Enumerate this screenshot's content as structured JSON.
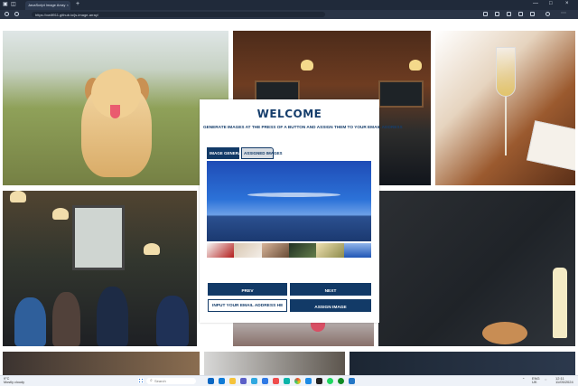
{
  "browser": {
    "tab_title": "JavaScript Image Array",
    "tab_close": "×",
    "new_tab": "+",
    "url": "https://xwill911.github.io/js-image-array/",
    "window_controls": [
      "—",
      "□",
      "×"
    ]
  },
  "modal": {
    "title": "WELCOME",
    "subtitle": "GENERATE IMAGES AT THE PRESS OF A BUTTON AND ASSIGN THEM TO YOUR EMAIL ADDRESS",
    "tabs": [
      {
        "label": "IMAGE GENERATOR"
      },
      {
        "label": "ASSIGNED IMAGES"
      }
    ],
    "buttons": {
      "prev": "PREV",
      "next": "NEXT",
      "assign": "ASSIGN IMAGE"
    },
    "email_placeholder": "INPUT YOUR EMAIL ADDRESS HERE"
  },
  "taskbar": {
    "weather_temp": "9°C",
    "weather_text": "Mostly cloudy",
    "search_placeholder": "Search",
    "language": "ENG",
    "region": "UK",
    "time": "12:11",
    "date": "11/05/2024"
  },
  "icons": [
    "back-icon",
    "refresh-icon",
    "search-icon",
    "windows-start-icon",
    "browser-icon",
    "mail-icon",
    "folder-icon",
    "chrome-icon",
    "code-icon"
  ]
}
